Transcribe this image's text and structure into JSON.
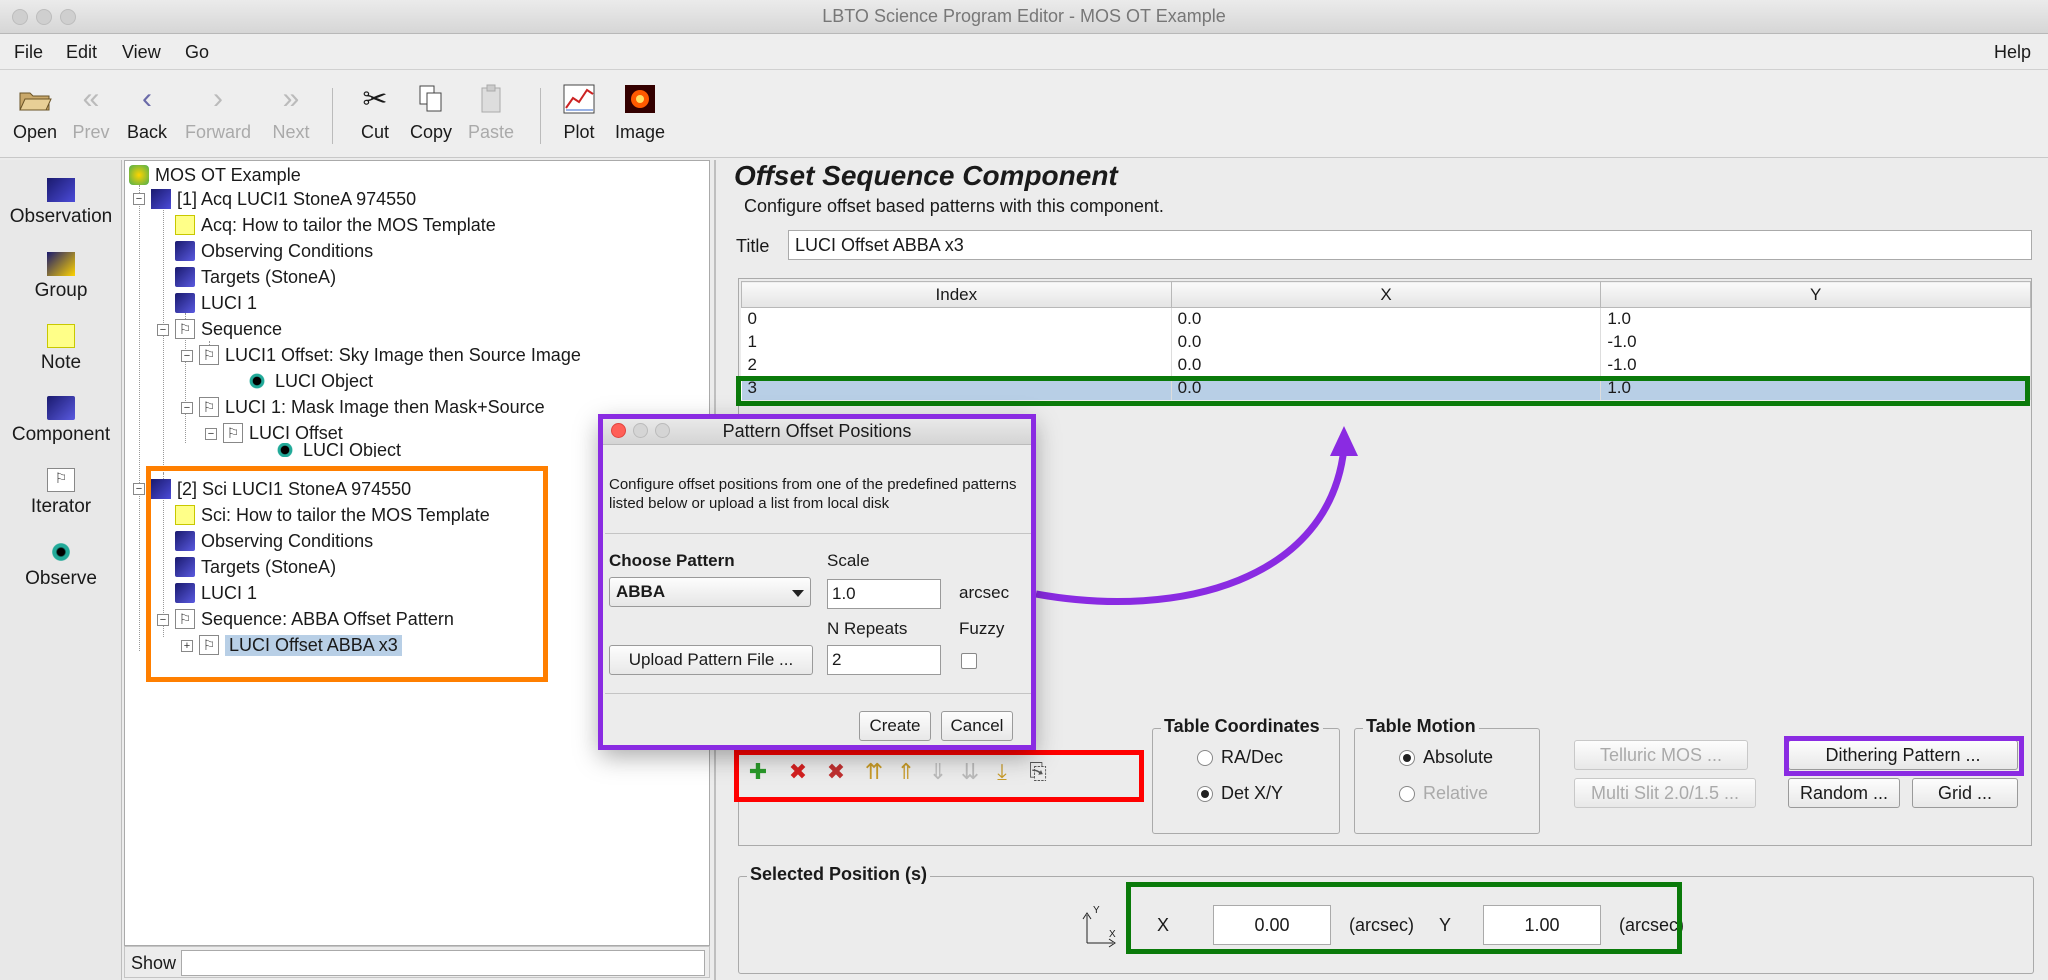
{
  "window": {
    "title": "LBTO Science Program Editor - MOS OT Example"
  },
  "menu": {
    "file": "File",
    "edit": "Edit",
    "view": "View",
    "go": "Go",
    "help": "Help"
  },
  "toolbar": {
    "open": "Open",
    "prev": "Prev",
    "back": "Back",
    "forward": "Forward",
    "next": "Next",
    "cut": "Cut",
    "copy": "Copy",
    "paste": "Paste",
    "plot": "Plot",
    "image": "Image"
  },
  "palette": {
    "observation": "Observation",
    "group": "Group",
    "note": "Note",
    "component": "Component",
    "iterator": "Iterator",
    "observe": "Observe"
  },
  "tree": {
    "root": "MOS OT Example",
    "n1": "[1] Acq LUCI1 StoneA 974550",
    "n2": "Acq: How to tailor the MOS Template",
    "n3": "Observing Conditions",
    "n4": "Targets (StoneA)",
    "n5": "LUCI 1",
    "n6": "Sequence",
    "n7": "LUCI1 Offset: Sky Image then Source Image",
    "n8": "LUCI Object",
    "n9": "LUCI 1: Mask Image then Mask+Source",
    "n10": "LUCI Offset",
    "n11": "LUCI Object",
    "n12": "[2] Sci LUCI1 StoneA 974550",
    "n13": "Sci: How to tailor the MOS Template",
    "n14": "Observing Conditions",
    "n15": "Targets (StoneA)",
    "n16": "LUCI 1",
    "n17": "Sequence: ABBA Offset Pattern",
    "n18": "LUCI Offset ABBA x3"
  },
  "show": {
    "label": "Show",
    "value": ""
  },
  "editor": {
    "heading": "Offset Sequence Component",
    "subtitle": "Configure offset based patterns with this component.",
    "title_label": "Title",
    "title_value": "LUCI Offset ABBA x3"
  },
  "table": {
    "headers": [
      "Index",
      "X",
      "Y"
    ],
    "rows": [
      [
        "0",
        "0.0",
        "1.0"
      ],
      [
        "1",
        "0.0",
        "-1.0"
      ],
      [
        "2",
        "0.0",
        "-1.0"
      ],
      [
        "3",
        "0.0",
        "1.0"
      ]
    ],
    "selected_row": 3
  },
  "coords": {
    "legend": "Table Coordinates",
    "radec": "RA/Dec",
    "detxy": "Det X/Y",
    "selected": "Det X/Y"
  },
  "motion": {
    "legend": "Table Motion",
    "absolute": "Absolute",
    "relative": "Relative",
    "selected": "Absolute"
  },
  "buttons": {
    "telluric": "Telluric MOS ...",
    "multislit": "Multi Slit 2.0/1.5 ...",
    "dithering": "Dithering Pattern ...",
    "random": "Random ...",
    "grid": "Grid ..."
  },
  "selected_position": {
    "legend": "Selected Position (s)",
    "x_label": "X",
    "x_value": "0.00",
    "x_unit": "(arcsec)",
    "y_label": "Y",
    "y_value": "1.00",
    "y_unit": "(arcsec)",
    "axis_y": "Y",
    "axis_x": "X"
  },
  "dialog": {
    "title": "Pattern Offset Positions",
    "description": "Configure offset positions from one of the predefined patterns listed below or upload a list from local disk",
    "choose_pattern_label": "Choose Pattern",
    "pattern_value": "ABBA",
    "scale_label": "Scale",
    "scale_value": "1.0",
    "scale_unit": "arcsec",
    "repeats_label": "N Repeats",
    "repeats_value": "2",
    "fuzzy_label": "Fuzzy",
    "upload_button": "Upload Pattern File ...",
    "create_button": "Create",
    "cancel_button": "Cancel"
  },
  "colors": {
    "highlight_orange": "#ff7f00",
    "highlight_purple": "#8a2be2",
    "highlight_green": "#0a7a0a",
    "highlight_red": "#ff0000",
    "selection": "#b8cfe6"
  },
  "icons": {
    "add": "add-icon",
    "delete": "delete-icon",
    "delete-all": "delete-all-icon",
    "move-top": "move-top-icon",
    "move-up": "move-up-icon",
    "move-down": "move-down-icon",
    "move-bottom": "move-bottom-icon",
    "move-last": "move-last-icon",
    "paste-row": "paste-row-icon"
  }
}
